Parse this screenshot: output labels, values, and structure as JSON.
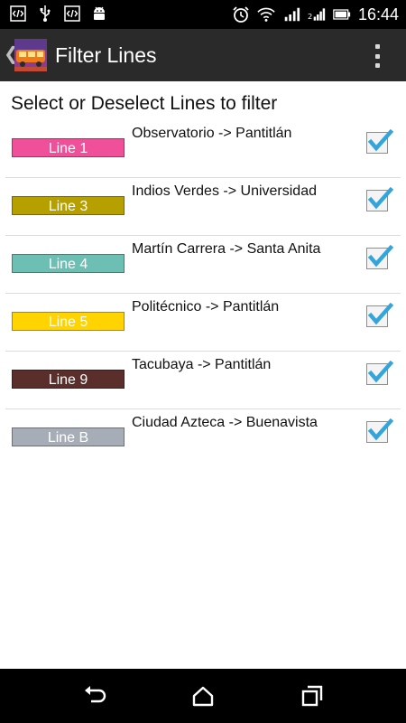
{
  "status_bar": {
    "time": "16:44",
    "left_icons": [
      "code-notification-icon",
      "usb-icon",
      "code-notification-icon",
      "android-debug-icon"
    ],
    "right_icons": [
      "alarm-icon",
      "wifi-icon",
      "signal-icon",
      "data-signal-icon",
      "battery-icon"
    ]
  },
  "action_bar": {
    "title": "Filter Lines"
  },
  "content": {
    "instruction": "Select or Deselect Lines to filter",
    "lines": [
      {
        "label": "Line 1",
        "route": "Observatorio -> Pantitlán",
        "color": "#f0509a",
        "checked": true
      },
      {
        "label": "Line 3",
        "route": "Indios Verdes -> Universidad",
        "color": "#b5a000",
        "checked": true
      },
      {
        "label": "Line 4",
        "route": "Martín Carrera -> Santa Anita",
        "color": "#6cbfb2",
        "checked": true
      },
      {
        "label": "Line 5",
        "route": "Politécnico -> Pantitlán",
        "color": "#ffd400",
        "checked": true
      },
      {
        "label": "Line 9",
        "route": "Tacubaya -> Pantitlán",
        "color": "#5a2e2b",
        "checked": true
      },
      {
        "label": "Line B",
        "route": "Ciudad Azteca -> Buenavista",
        "color": "#a7adb6",
        "checked": true
      }
    ]
  },
  "colors": {
    "status_bar": "#000000",
    "action_bar": "#2a2a2a",
    "check_accent": "#33a5db"
  },
  "nav_bar": {
    "buttons": [
      "back-icon",
      "home-icon",
      "recent-apps-icon"
    ]
  }
}
